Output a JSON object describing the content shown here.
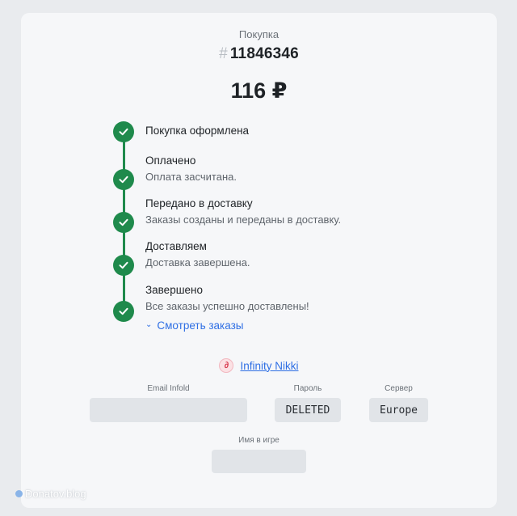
{
  "header": {
    "purchase_label": "Покупка",
    "order_hash": "#",
    "order_number": "11846346",
    "price": "116 ₽"
  },
  "timeline": {
    "accent_color": "#1f8a4c",
    "steps": [
      {
        "title": "Покупка оформлена",
        "subtitle": ""
      },
      {
        "title": "Оплачено",
        "subtitle": "Оплата засчитана."
      },
      {
        "title": "Передано в доставку",
        "subtitle": "Заказы созданы и переданы в доставку."
      },
      {
        "title": "Доставляем",
        "subtitle": "Доставка завершена."
      },
      {
        "title": "Завершено",
        "subtitle": "Все заказы успешно доставлены!"
      }
    ],
    "view_orders_label": "Смотреть заказы"
  },
  "game": {
    "icon": "game-logo-icon",
    "logo_letter": "∂",
    "name": "Infinity Nikki"
  },
  "fields": {
    "email_label": "Email Infold",
    "email_value": "",
    "password_label": "Пароль",
    "password_value": "DELETED",
    "server_label": "Сервер",
    "server_value": "Europe",
    "ingame_name_label": "Имя в игре",
    "ingame_name_value": ""
  },
  "watermark": "Donatov.blog"
}
